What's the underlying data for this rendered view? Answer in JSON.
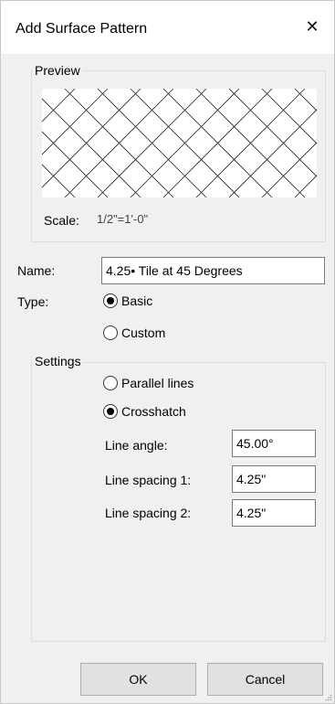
{
  "window": {
    "title": "Add Surface Pattern",
    "close_glyph": "✕"
  },
  "preview": {
    "group_label": "Preview",
    "scale_label": "Scale:",
    "scale_value": "1/2\"=1'-0\""
  },
  "form": {
    "name_label": "Name:",
    "name_value": "4.25• Tile at 45 Degrees",
    "type_label": "Type:",
    "type_options": [
      {
        "label": "Basic",
        "selected": true
      },
      {
        "label": "Custom",
        "selected": false
      }
    ]
  },
  "settings": {
    "group_label": "Settings",
    "mode_options": [
      {
        "label": "Parallel lines",
        "selected": false
      },
      {
        "label": "Crosshatch",
        "selected": true
      }
    ],
    "line_angle_label": "Line angle:",
    "line_angle_value": "45.00°",
    "spacing1_label": "Line spacing 1:",
    "spacing1_value": "4.25\"",
    "spacing2_label": "Line spacing 2:",
    "spacing2_value": "4.25\""
  },
  "buttons": {
    "ok": "OK",
    "cancel": "Cancel"
  },
  "colors": {
    "dialog_bg": "#f0f0f0",
    "titlebar_bg": "#ffffff",
    "button_bg": "#e1e1e1"
  },
  "icons": {
    "close": "close-icon",
    "radio_selected": "radio-checked-icon",
    "radio_unselected": "radio-unchecked-icon",
    "resize": "resize-grip-icon"
  }
}
